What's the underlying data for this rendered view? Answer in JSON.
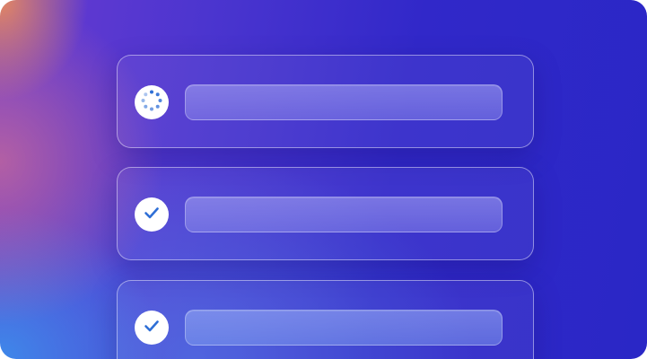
{
  "colors": {
    "accent": "#2f6fd6",
    "icon_bg": "#ffffff",
    "background_start": "#e88b5a",
    "background_end": "#2a27c6"
  },
  "items": [
    {
      "status": "loading",
      "icon": "loading-spinner-icon"
    },
    {
      "status": "complete",
      "icon": "checkmark-icon"
    },
    {
      "status": "complete",
      "icon": "checkmark-icon"
    }
  ]
}
